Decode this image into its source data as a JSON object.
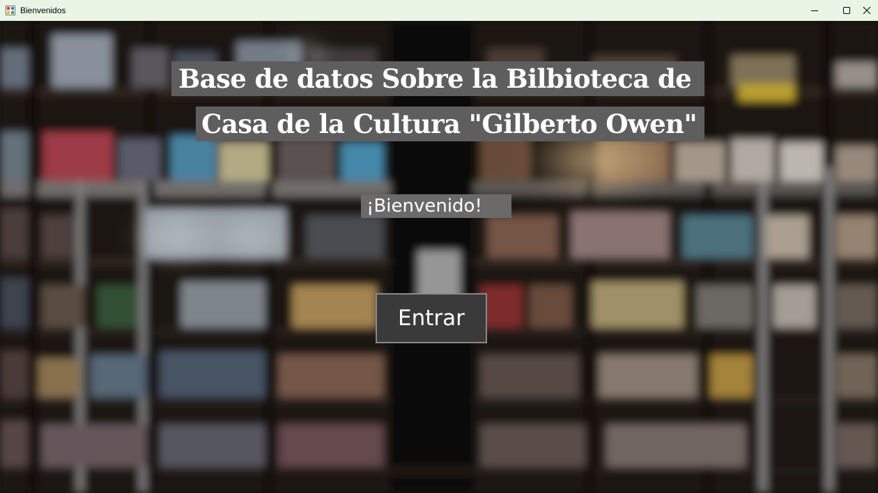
{
  "window": {
    "title": "Bienvenidos",
    "minimize_icon": "minimize-icon",
    "maximize_icon": "maximize-icon",
    "close_icon": "close-icon"
  },
  "main": {
    "title_line_1": "Base de datos Sobre la Bilbioteca de",
    "title_line_2": "Casa de la Cultura \"Gilberto Owen\"",
    "welcome_label": "¡Bienvenido!",
    "enter_button": "Entrar",
    "background_image": "blurred-library-bookshelves"
  },
  "colors": {
    "titlebar": "#eaf5e6",
    "label_background": "#5e5e5e",
    "button_background": "#3a3a3a",
    "text": "#ffffff"
  }
}
